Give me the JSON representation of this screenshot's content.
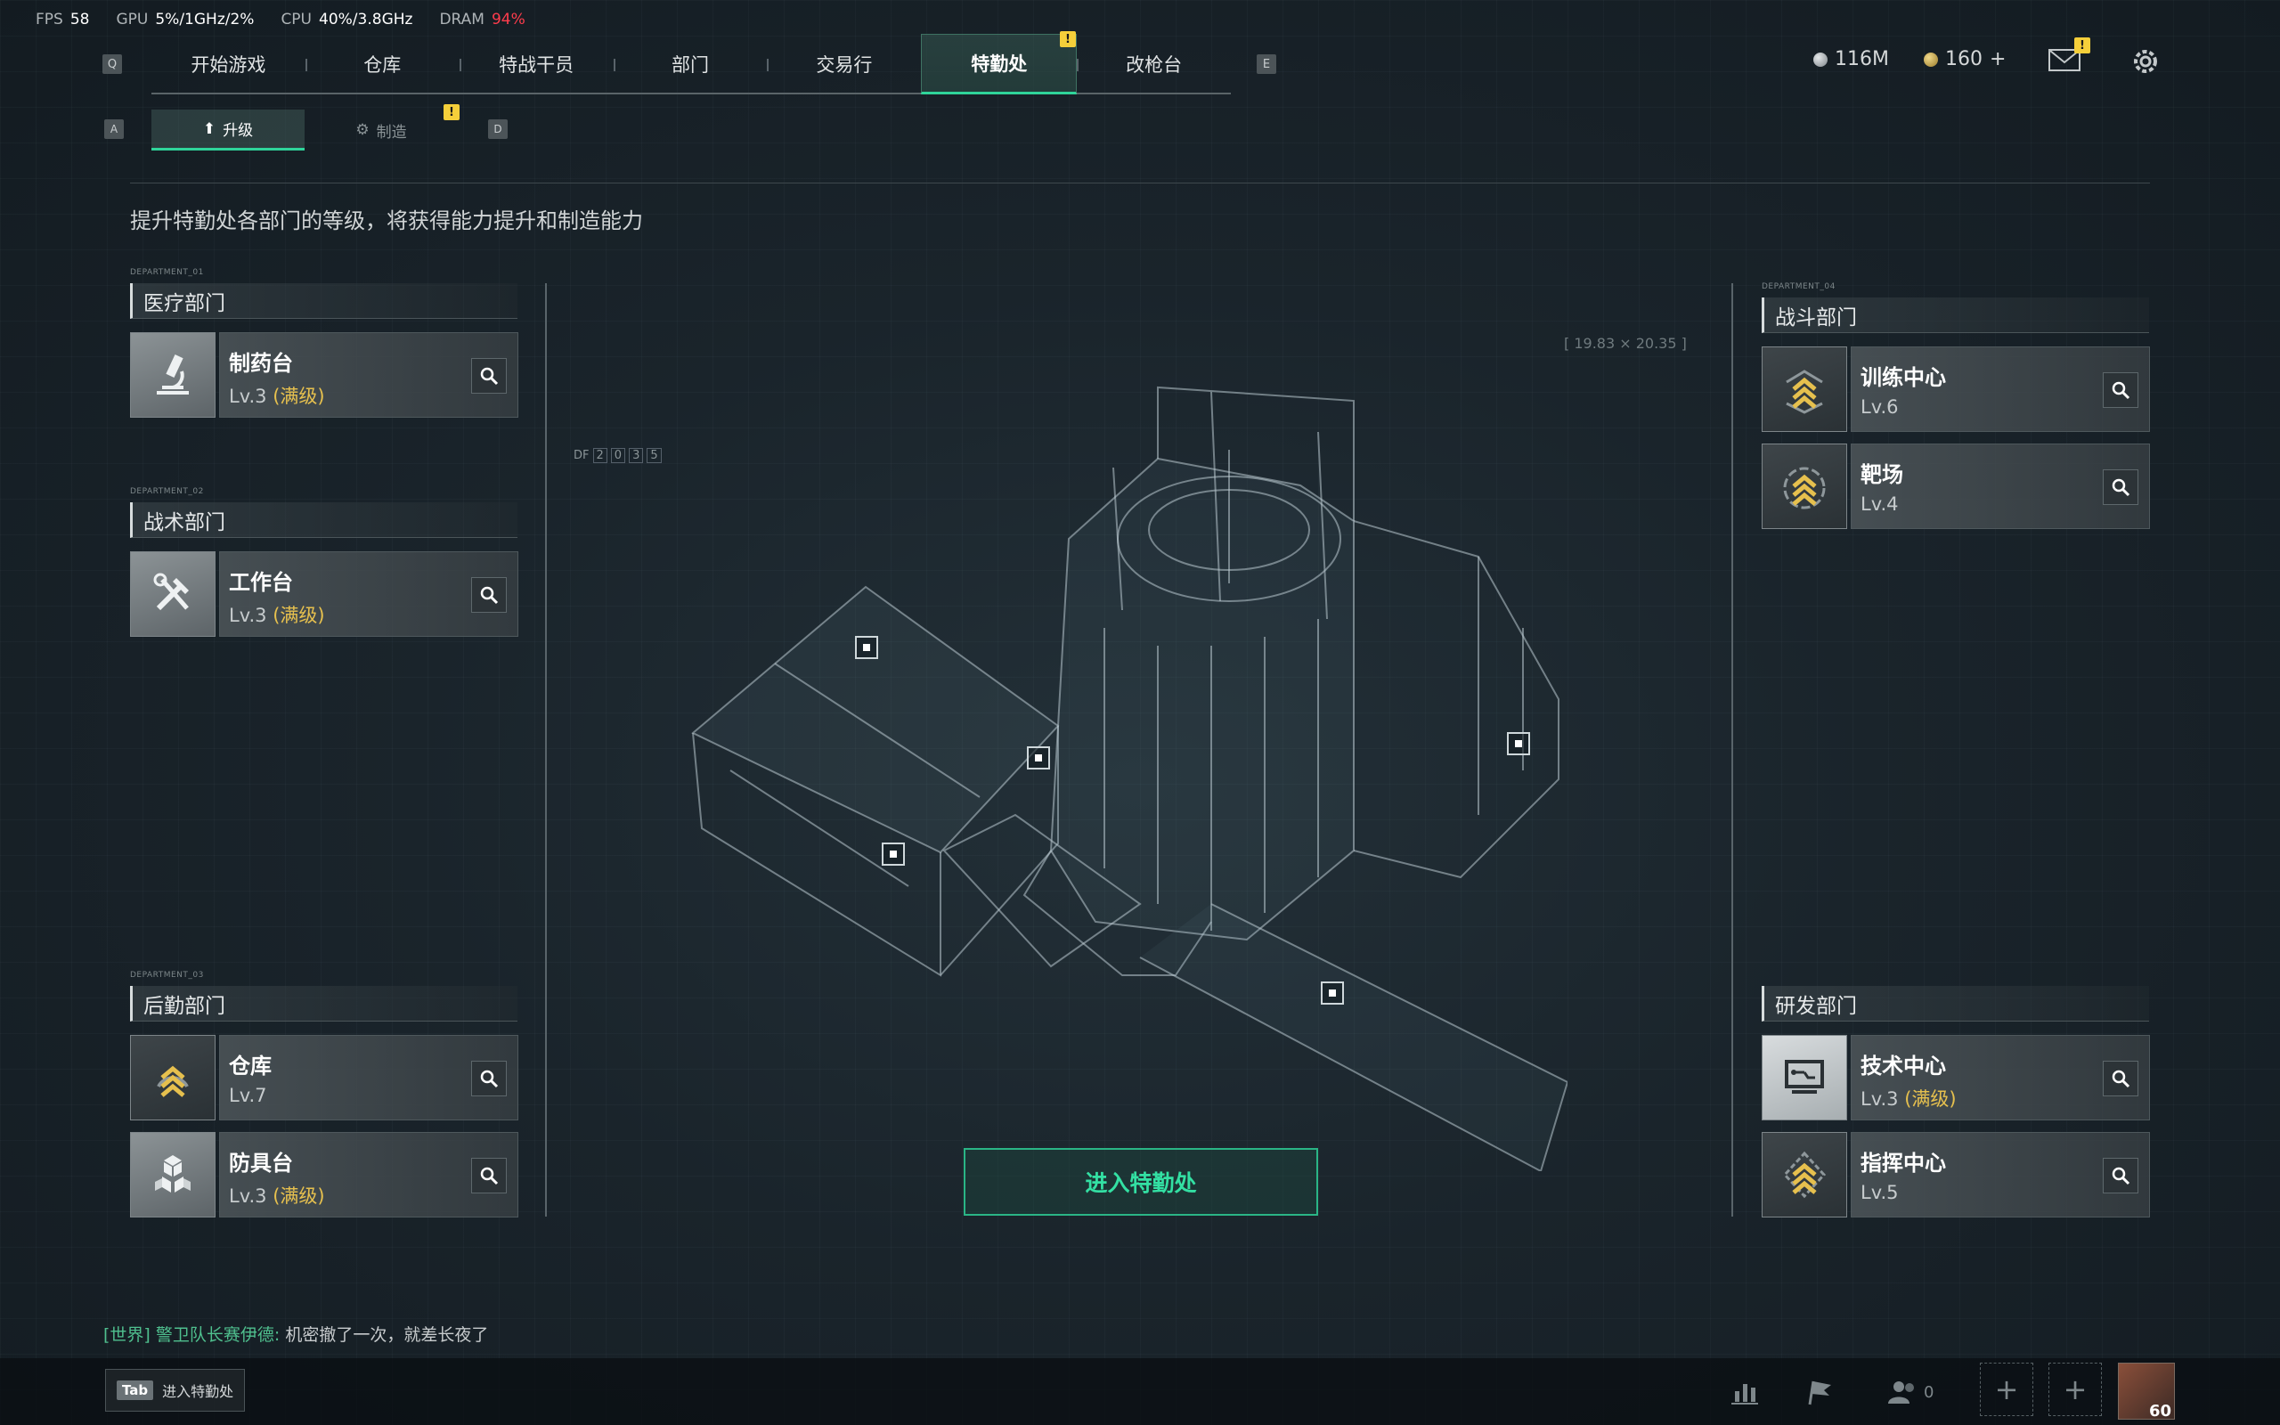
{
  "perf": {
    "fps_label": "FPS",
    "fps": "58",
    "gpu_label": "GPU",
    "gpu": "5%/1GHz/2%",
    "cpu_label": "CPU",
    "cpu": "40%/3.8GHz",
    "dram_label": "DRAM",
    "dram": "94%"
  },
  "nav": {
    "left_key": "Q",
    "right_key": "E",
    "tabs": [
      "开始游戏",
      "仓库",
      "特战干员",
      "部门",
      "交易行",
      "特勤处",
      "改枪台"
    ],
    "active_tab": "特勤处",
    "alert": "!"
  },
  "currency": {
    "coins": "116M",
    "tokens": "160",
    "tokens_add": "+",
    "mail_alert": "!"
  },
  "subtabs": {
    "left_key": "A",
    "right_key": "D",
    "upgrade": "升级",
    "craft": "制造",
    "alert": "!"
  },
  "description": "提升特勤处各部门的等级，将获得能力提升和制造能力",
  "departments": {
    "medical": {
      "tag": "DEPARTMENT_01",
      "title": "医疗部门",
      "items": [
        {
          "name": "制药台",
          "level": "Lv.3",
          "max": "(满级)"
        }
      ]
    },
    "tactical": {
      "tag": "DEPARTMENT_02",
      "title": "战术部门",
      "items": [
        {
          "name": "工作台",
          "level": "Lv.3",
          "max": "(满级)"
        }
      ]
    },
    "logistics": {
      "tag": "DEPARTMENT_03",
      "title": "后勤部门",
      "items": [
        {
          "name": "仓库",
          "level": "Lv.7",
          "max": ""
        },
        {
          "name": "防具台",
          "level": "Lv.3",
          "max": "(满级)"
        }
      ]
    },
    "combat": {
      "tag": "DEPARTMENT_04",
      "title": "战斗部门",
      "items": [
        {
          "name": "训练中心",
          "level": "Lv.6",
          "max": ""
        },
        {
          "name": "靶场",
          "level": "Lv.4",
          "max": ""
        }
      ]
    },
    "research": {
      "title": "研发部门",
      "items": [
        {
          "name": "技术中心",
          "level": "Lv.3",
          "max": "(满级)"
        },
        {
          "name": "指挥中心",
          "level": "Lv.5",
          "max": ""
        }
      ]
    }
  },
  "deco": {
    "df_label": "DF",
    "df_digits": [
      "2",
      "0",
      "3",
      "5"
    ],
    "coords": "[ 19.83 × 20.35 ]"
  },
  "enter_button": "进入特勤处",
  "chat": {
    "channel": "[世界]",
    "sender": "警卫队长赛伊德:",
    "message": "机密撤了一次，就差长夜了"
  },
  "bottom": {
    "tab_key": "Tab",
    "tab_label": "进入特勤处",
    "team_count": "0",
    "avatar_level": "60"
  },
  "colors": {
    "accent": "#2fd49a",
    "max_level": "#e6c04e",
    "alert": "#f5cf3a",
    "dram_warn": "#ff3c4c"
  }
}
